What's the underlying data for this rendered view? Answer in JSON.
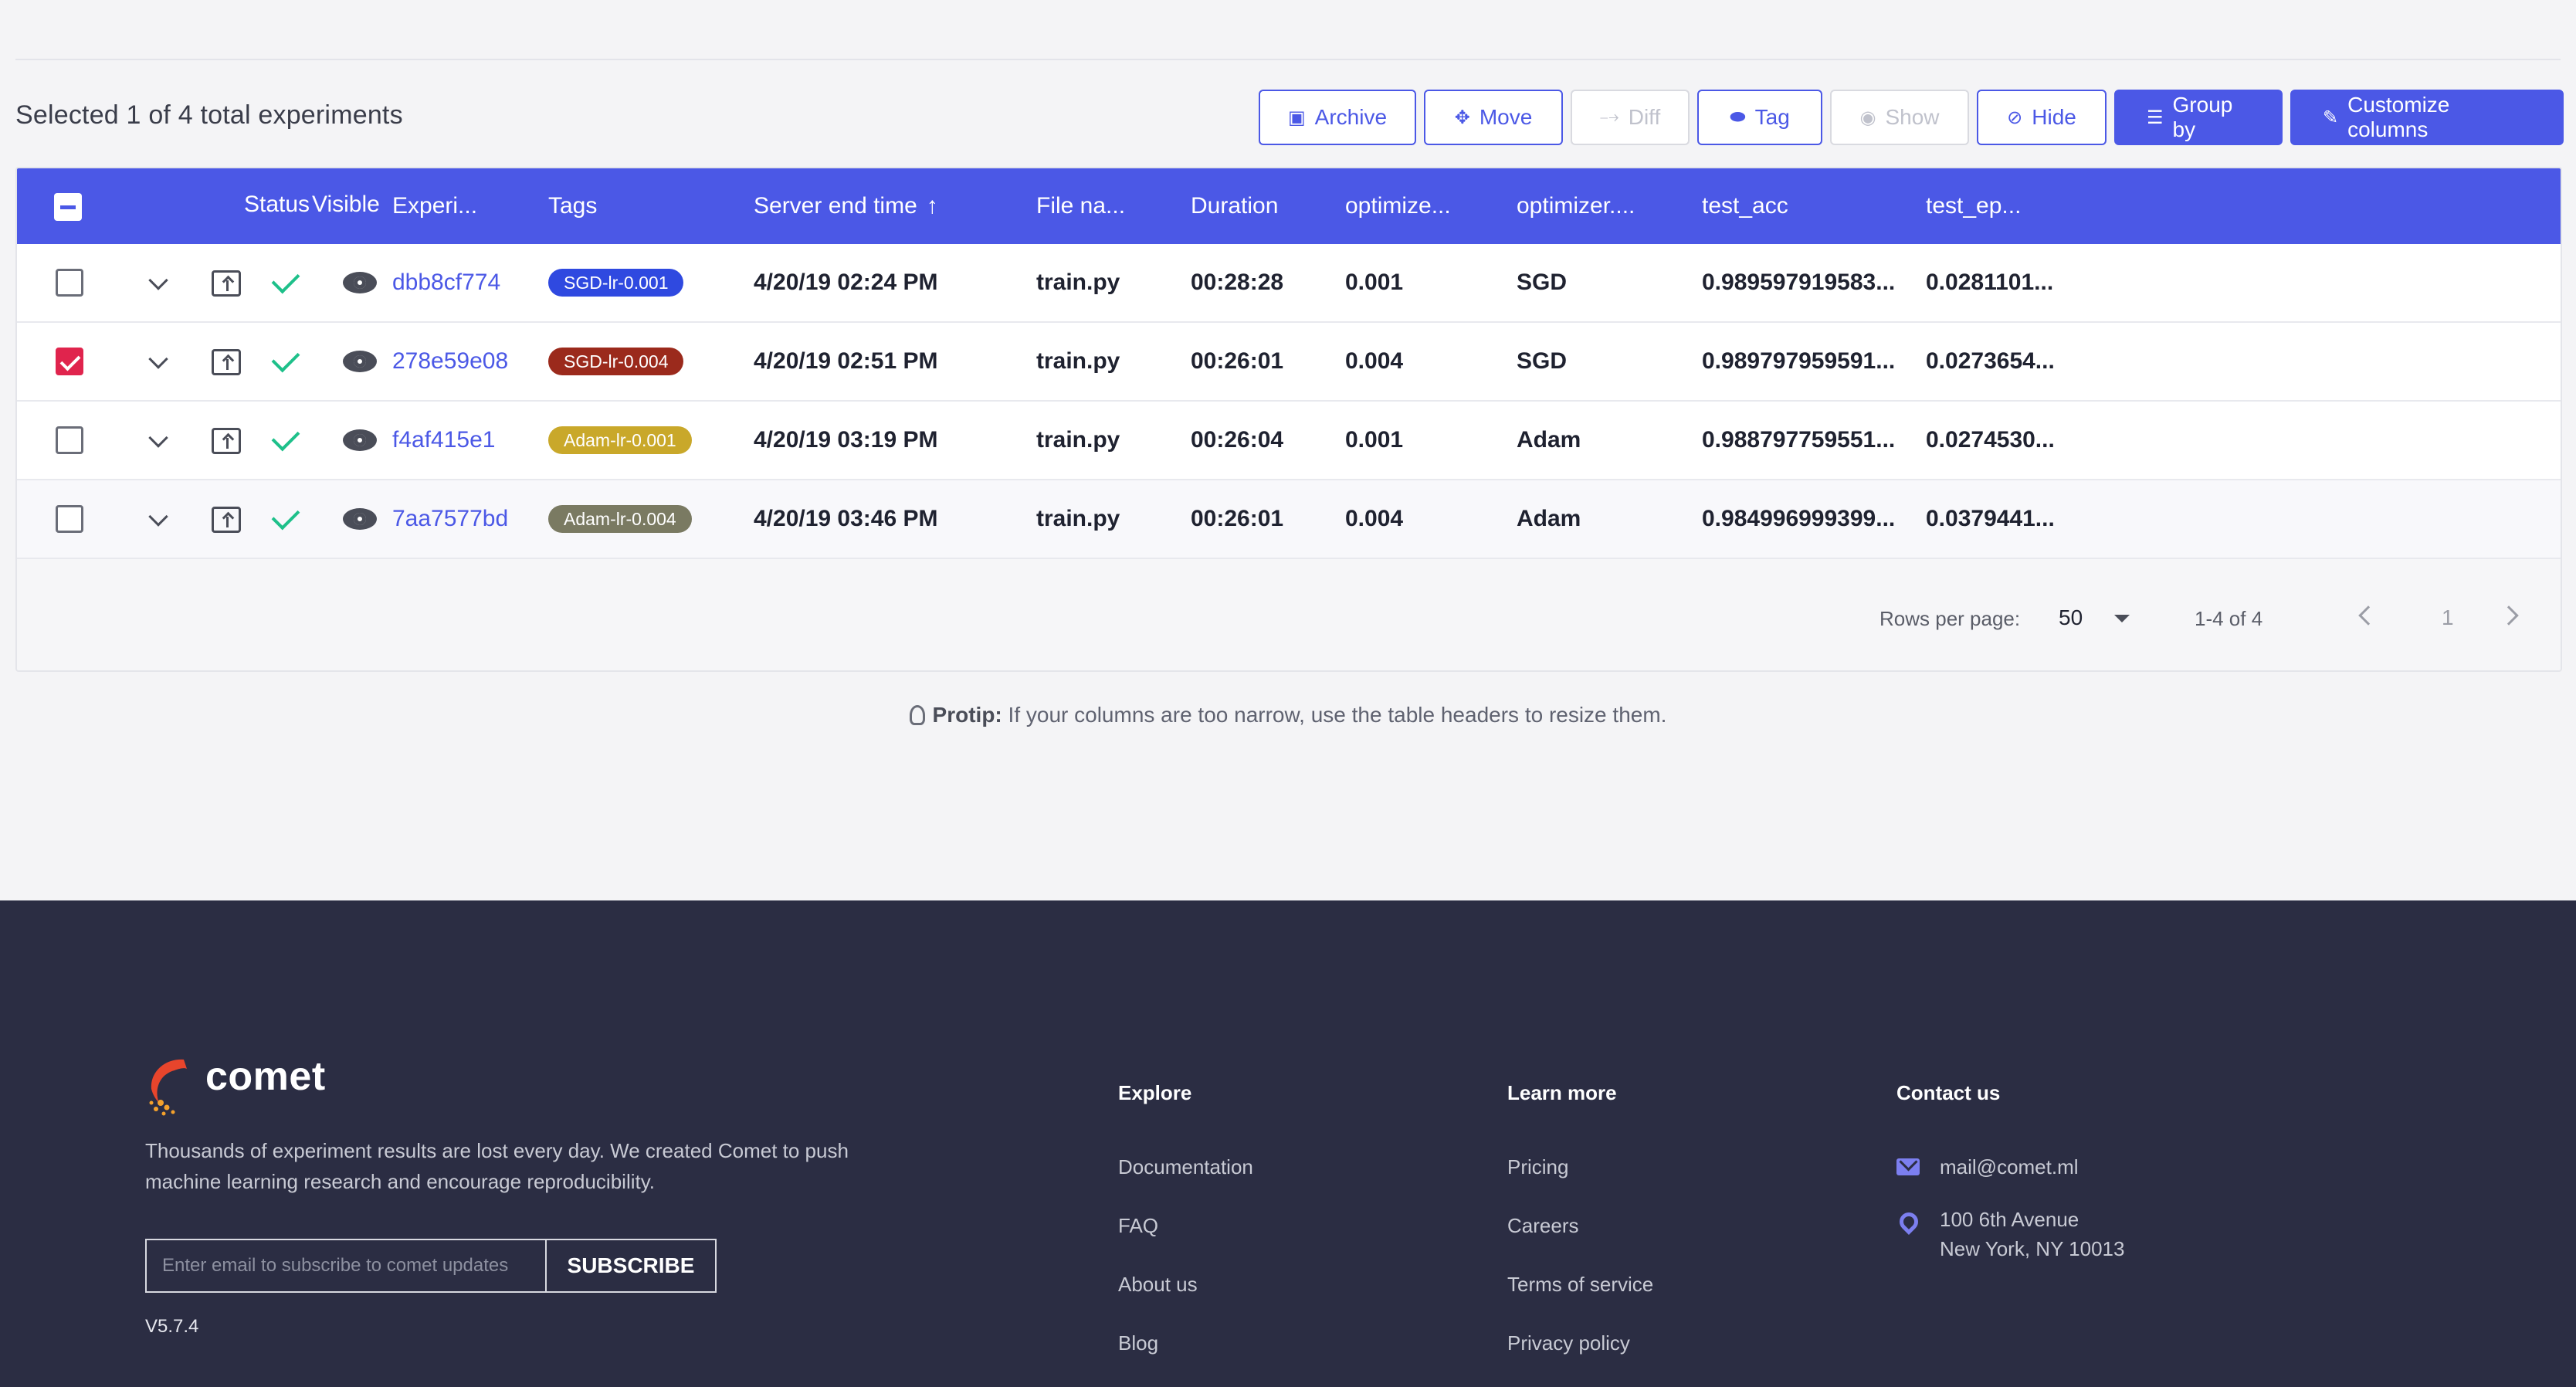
{
  "header": {
    "selected_text": "Selected 1 of 4 total experiments"
  },
  "toolbar": {
    "archive": "Archive",
    "move": "Move",
    "diff": "Diff",
    "tag": "Tag",
    "show": "Show",
    "hide": "Hide",
    "group_by": "Group by",
    "customize": "Customize columns"
  },
  "table": {
    "columns": {
      "status": "Status",
      "visible": "Visible",
      "experiment": "Experi...",
      "tags": "Tags",
      "server_end": "Server end time",
      "file_name": "File na...",
      "duration": "Duration",
      "optimizer_lr": "optimize...",
      "optimizer": "optimizer....",
      "test_acc": "test_acc",
      "test_ep": "test_ep..."
    },
    "rows": [
      {
        "checked": false,
        "exp": "dbb8cf774",
        "tag": "SGD-lr-0.001",
        "tag_color": "#2f49e0",
        "end": "4/20/19 02:24 PM",
        "file": "train.py",
        "duration": "00:28:28",
        "lr": "0.001",
        "opt": "SGD",
        "acc": "0.989597919583...",
        "ep": "0.0281101..."
      },
      {
        "checked": true,
        "exp": "278e59e08",
        "tag": "SGD-lr-0.004",
        "tag_color": "#9b2a1c",
        "end": "4/20/19 02:51 PM",
        "file": "train.py",
        "duration": "00:26:01",
        "lr": "0.004",
        "opt": "SGD",
        "acc": "0.989797959591...",
        "ep": "0.0273654..."
      },
      {
        "checked": false,
        "exp": "f4af415e1",
        "tag": "Adam-lr-0.001",
        "tag_color": "#c9a82a",
        "end": "4/20/19 03:19 PM",
        "file": "train.py",
        "duration": "00:26:04",
        "lr": "0.001",
        "opt": "Adam",
        "acc": "0.988797759551...",
        "ep": "0.0274530..."
      },
      {
        "checked": false,
        "exp": "7aa7577bd",
        "tag": "Adam-lr-0.004",
        "tag_color": "#7a7a62",
        "end": "4/20/19 03:46 PM",
        "file": "train.py",
        "duration": "00:26:01",
        "lr": "0.004",
        "opt": "Adam",
        "acc": "0.984996999399...",
        "ep": "0.0379441..."
      }
    ]
  },
  "pagination": {
    "rows_label": "Rows per page:",
    "rows_value": "50",
    "range": "1-4 of 4",
    "page": "1"
  },
  "protip": {
    "label": "Protip:",
    "text": "If your columns are too narrow, use the table headers to resize them."
  },
  "footer": {
    "brand": "comet",
    "tagline": "Thousands of experiment results are lost every day. We created Comet to push machine learning research and encourage reproducibility.",
    "email_placeholder": "Enter email to subscribe to comet updates",
    "subscribe": "SUBSCRIBE",
    "version": "V5.7.4",
    "explore": {
      "title": "Explore",
      "links": [
        "Documentation",
        "FAQ",
        "About us",
        "Blog"
      ]
    },
    "learn": {
      "title": "Learn more",
      "links": [
        "Pricing",
        "Careers",
        "Terms of service",
        "Privacy policy"
      ]
    },
    "contact": {
      "title": "Contact us",
      "email": "mail@comet.ml",
      "address_1": "100 6th Avenue",
      "address_2": "New York, NY 10013"
    }
  },
  "colors": {
    "accent": "#4b58e6",
    "footer_bg": "#2b2d43",
    "success": "#1ec08a",
    "checked": "#e0244d"
  }
}
